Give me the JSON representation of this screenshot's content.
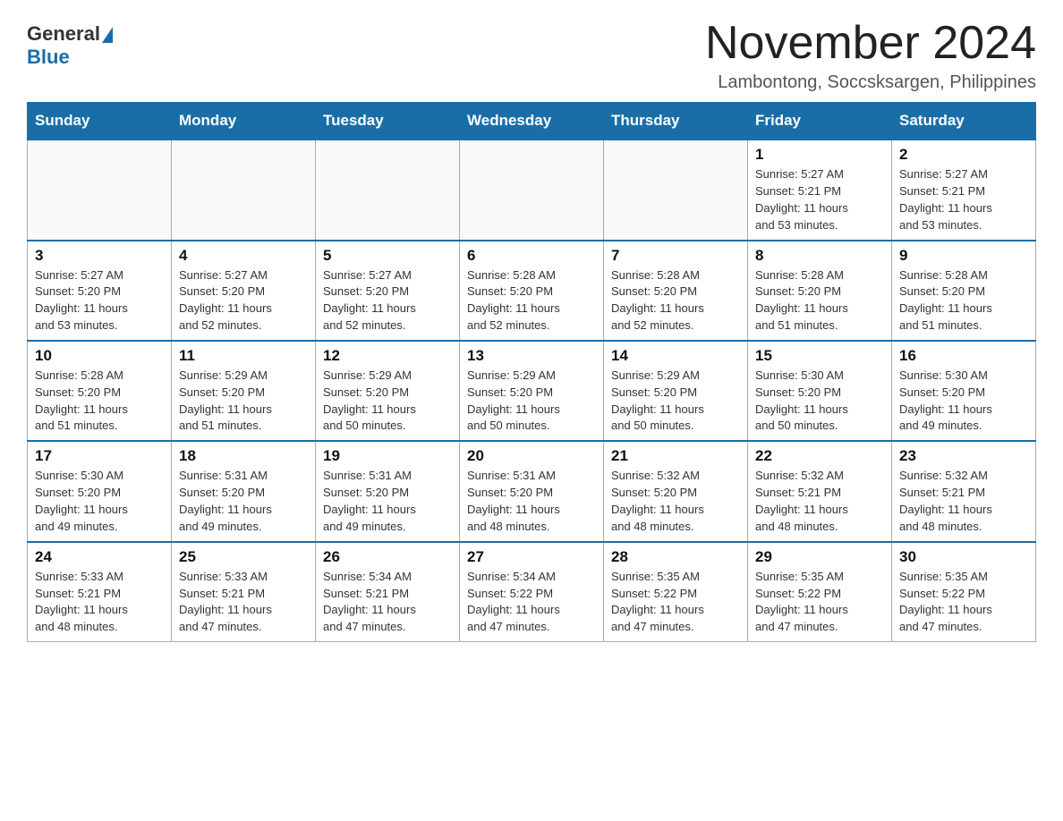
{
  "logo": {
    "general": "General",
    "blue": "Blue"
  },
  "title": "November 2024",
  "location": "Lambontong, Soccsksargen, Philippines",
  "weekdays": [
    "Sunday",
    "Monday",
    "Tuesday",
    "Wednesday",
    "Thursday",
    "Friday",
    "Saturday"
  ],
  "weeks": [
    [
      {
        "day": "",
        "info": ""
      },
      {
        "day": "",
        "info": ""
      },
      {
        "day": "",
        "info": ""
      },
      {
        "day": "",
        "info": ""
      },
      {
        "day": "",
        "info": ""
      },
      {
        "day": "1",
        "info": "Sunrise: 5:27 AM\nSunset: 5:21 PM\nDaylight: 11 hours\nand 53 minutes."
      },
      {
        "day": "2",
        "info": "Sunrise: 5:27 AM\nSunset: 5:21 PM\nDaylight: 11 hours\nand 53 minutes."
      }
    ],
    [
      {
        "day": "3",
        "info": "Sunrise: 5:27 AM\nSunset: 5:20 PM\nDaylight: 11 hours\nand 53 minutes."
      },
      {
        "day": "4",
        "info": "Sunrise: 5:27 AM\nSunset: 5:20 PM\nDaylight: 11 hours\nand 52 minutes."
      },
      {
        "day": "5",
        "info": "Sunrise: 5:27 AM\nSunset: 5:20 PM\nDaylight: 11 hours\nand 52 minutes."
      },
      {
        "day": "6",
        "info": "Sunrise: 5:28 AM\nSunset: 5:20 PM\nDaylight: 11 hours\nand 52 minutes."
      },
      {
        "day": "7",
        "info": "Sunrise: 5:28 AM\nSunset: 5:20 PM\nDaylight: 11 hours\nand 52 minutes."
      },
      {
        "day": "8",
        "info": "Sunrise: 5:28 AM\nSunset: 5:20 PM\nDaylight: 11 hours\nand 51 minutes."
      },
      {
        "day": "9",
        "info": "Sunrise: 5:28 AM\nSunset: 5:20 PM\nDaylight: 11 hours\nand 51 minutes."
      }
    ],
    [
      {
        "day": "10",
        "info": "Sunrise: 5:28 AM\nSunset: 5:20 PM\nDaylight: 11 hours\nand 51 minutes."
      },
      {
        "day": "11",
        "info": "Sunrise: 5:29 AM\nSunset: 5:20 PM\nDaylight: 11 hours\nand 51 minutes."
      },
      {
        "day": "12",
        "info": "Sunrise: 5:29 AM\nSunset: 5:20 PM\nDaylight: 11 hours\nand 50 minutes."
      },
      {
        "day": "13",
        "info": "Sunrise: 5:29 AM\nSunset: 5:20 PM\nDaylight: 11 hours\nand 50 minutes."
      },
      {
        "day": "14",
        "info": "Sunrise: 5:29 AM\nSunset: 5:20 PM\nDaylight: 11 hours\nand 50 minutes."
      },
      {
        "day": "15",
        "info": "Sunrise: 5:30 AM\nSunset: 5:20 PM\nDaylight: 11 hours\nand 50 minutes."
      },
      {
        "day": "16",
        "info": "Sunrise: 5:30 AM\nSunset: 5:20 PM\nDaylight: 11 hours\nand 49 minutes."
      }
    ],
    [
      {
        "day": "17",
        "info": "Sunrise: 5:30 AM\nSunset: 5:20 PM\nDaylight: 11 hours\nand 49 minutes."
      },
      {
        "day": "18",
        "info": "Sunrise: 5:31 AM\nSunset: 5:20 PM\nDaylight: 11 hours\nand 49 minutes."
      },
      {
        "day": "19",
        "info": "Sunrise: 5:31 AM\nSunset: 5:20 PM\nDaylight: 11 hours\nand 49 minutes."
      },
      {
        "day": "20",
        "info": "Sunrise: 5:31 AM\nSunset: 5:20 PM\nDaylight: 11 hours\nand 48 minutes."
      },
      {
        "day": "21",
        "info": "Sunrise: 5:32 AM\nSunset: 5:20 PM\nDaylight: 11 hours\nand 48 minutes."
      },
      {
        "day": "22",
        "info": "Sunrise: 5:32 AM\nSunset: 5:21 PM\nDaylight: 11 hours\nand 48 minutes."
      },
      {
        "day": "23",
        "info": "Sunrise: 5:32 AM\nSunset: 5:21 PM\nDaylight: 11 hours\nand 48 minutes."
      }
    ],
    [
      {
        "day": "24",
        "info": "Sunrise: 5:33 AM\nSunset: 5:21 PM\nDaylight: 11 hours\nand 48 minutes."
      },
      {
        "day": "25",
        "info": "Sunrise: 5:33 AM\nSunset: 5:21 PM\nDaylight: 11 hours\nand 47 minutes."
      },
      {
        "day": "26",
        "info": "Sunrise: 5:34 AM\nSunset: 5:21 PM\nDaylight: 11 hours\nand 47 minutes."
      },
      {
        "day": "27",
        "info": "Sunrise: 5:34 AM\nSunset: 5:22 PM\nDaylight: 11 hours\nand 47 minutes."
      },
      {
        "day": "28",
        "info": "Sunrise: 5:35 AM\nSunset: 5:22 PM\nDaylight: 11 hours\nand 47 minutes."
      },
      {
        "day": "29",
        "info": "Sunrise: 5:35 AM\nSunset: 5:22 PM\nDaylight: 11 hours\nand 47 minutes."
      },
      {
        "day": "30",
        "info": "Sunrise: 5:35 AM\nSunset: 5:22 PM\nDaylight: 11 hours\nand 47 minutes."
      }
    ]
  ]
}
